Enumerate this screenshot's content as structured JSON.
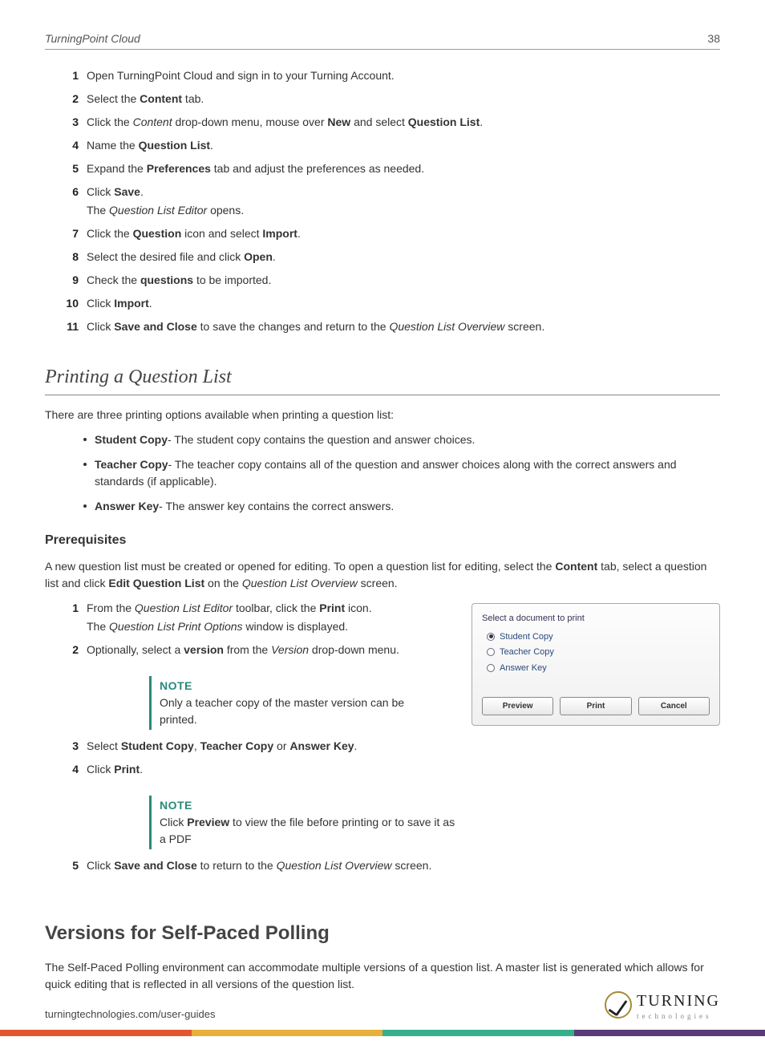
{
  "header": {
    "title": "TurningPoint Cloud",
    "page": "38"
  },
  "steps_a": [
    {
      "n": "1",
      "parts": [
        {
          "t": "Open TurningPoint Cloud and sign in to your Turning Account."
        }
      ]
    },
    {
      "n": "2",
      "parts": [
        {
          "t": "Select the "
        },
        {
          "b": "Content"
        },
        {
          "t": " tab."
        }
      ]
    },
    {
      "n": "3",
      "parts": [
        {
          "t": "Click the "
        },
        {
          "i": "Content"
        },
        {
          "t": " drop-down menu, mouse over "
        },
        {
          "b": "New"
        },
        {
          "t": " and select "
        },
        {
          "b": "Question List"
        },
        {
          "t": "."
        }
      ]
    },
    {
      "n": "4",
      "parts": [
        {
          "t": "Name the "
        },
        {
          "b": "Question List"
        },
        {
          "t": "."
        }
      ]
    },
    {
      "n": "5",
      "parts": [
        {
          "t": "Expand the "
        },
        {
          "b": "Preferences"
        },
        {
          "t": " tab and adjust the preferences as needed."
        }
      ]
    },
    {
      "n": "6",
      "parts": [
        {
          "t": "Click "
        },
        {
          "b": "Save"
        },
        {
          "t": "."
        }
      ],
      "sub": [
        {
          "t": "The "
        },
        {
          "i": "Question List Editor"
        },
        {
          "t": " opens."
        }
      ]
    },
    {
      "n": "7",
      "parts": [
        {
          "t": "Click the "
        },
        {
          "b": "Question"
        },
        {
          "t": " icon and select "
        },
        {
          "b": "Import"
        },
        {
          "t": "."
        }
      ]
    },
    {
      "n": "8",
      "parts": [
        {
          "t": "Select the desired file and click "
        },
        {
          "b": "Open"
        },
        {
          "t": "."
        }
      ]
    },
    {
      "n": "9",
      "parts": [
        {
          "t": "Check the "
        },
        {
          "b": "questions"
        },
        {
          "t": " to be imported."
        }
      ]
    },
    {
      "n": "10",
      "parts": [
        {
          "t": "Click "
        },
        {
          "b": "Import"
        },
        {
          "t": "."
        }
      ]
    },
    {
      "n": "11",
      "parts": [
        {
          "t": "Click "
        },
        {
          "b": "Save and Close"
        },
        {
          "t": " to save the changes and return to the "
        },
        {
          "i": "Question List Overview"
        },
        {
          "t": " screen."
        }
      ]
    }
  ],
  "section_print": "Printing a Question List",
  "print_intro": "There are three printing options available when printing a question list:",
  "print_bullets": [
    [
      {
        "b": "Student Copy"
      },
      {
        "t": "- The student copy contains the question and answer choices."
      }
    ],
    [
      {
        "b": "Teacher Copy"
      },
      {
        "t": "- The teacher copy contains all of the question and answer choices along with the correct answers and standards (if applicable)."
      }
    ],
    [
      {
        "b": "Answer Key"
      },
      {
        "t": "- The answer key contains the correct answers."
      }
    ]
  ],
  "prereq_heading": "Prerequisites",
  "prereq_text": [
    {
      "t": "A new question list must be created or opened for editing. To open a question list for editing, select the "
    },
    {
      "b": "Content"
    },
    {
      "t": " tab, select a question list and click "
    },
    {
      "b": "Edit Question List"
    },
    {
      "t": " on the "
    },
    {
      "i": "Question List Overview"
    },
    {
      "t": " screen."
    }
  ],
  "steps_b": [
    {
      "n": "1",
      "parts": [
        {
          "t": "From the "
        },
        {
          "i": "Question List Editor"
        },
        {
          "t": " toolbar, click the "
        },
        {
          "b": "Print"
        },
        {
          "t": " icon."
        }
      ],
      "sub": [
        {
          "t": "The "
        },
        {
          "i": "Question List Print Options"
        },
        {
          "t": " window is displayed."
        }
      ]
    },
    {
      "n": "2",
      "parts": [
        {
          "t": "Optionally, select a "
        },
        {
          "b": "version"
        },
        {
          "t": " from the "
        },
        {
          "i": "Version"
        },
        {
          "t": " drop-down menu."
        }
      ]
    }
  ],
  "note1_title": "NOTE",
  "note1_body": "Only a teacher copy of the master version can be printed.",
  "steps_c": [
    {
      "n": "3",
      "parts": [
        {
          "t": "Select "
        },
        {
          "b": "Student Copy"
        },
        {
          "t": ", "
        },
        {
          "b": "Teacher Copy"
        },
        {
          "t": " or "
        },
        {
          "b": "Answer Key"
        },
        {
          "t": "."
        }
      ]
    },
    {
      "n": "4",
      "parts": [
        {
          "t": "Click "
        },
        {
          "b": "Print"
        },
        {
          "t": "."
        }
      ]
    }
  ],
  "note2_title": "NOTE",
  "note2_body": [
    {
      "t": "Click "
    },
    {
      "b": "Preview"
    },
    {
      "t": " to view the file before printing or to save it as a PDF"
    }
  ],
  "steps_d": [
    {
      "n": "5",
      "parts": [
        {
          "t": "Click "
        },
        {
          "b": "Save and Close"
        },
        {
          "t": " to return to the "
        },
        {
          "i": "Question List Overview"
        },
        {
          "t": " screen."
        }
      ]
    }
  ],
  "dialog": {
    "heading": "Select a document to print",
    "options": [
      "Student Copy",
      "Teacher Copy",
      "Answer Key"
    ],
    "selected": 0,
    "buttons": [
      "Preview",
      "Print",
      "Cancel"
    ]
  },
  "section_versions": "Versions for Self-Paced Polling",
  "versions_body": "The Self-Paced Polling environment can accommodate multiple versions of a question list. A master list is generated which allows for quick editing that is reflected in all versions of the question list.",
  "footer_url": "turningtechnologies.com/user-guides",
  "logo_main": "TURNING",
  "logo_sub": "technologies"
}
